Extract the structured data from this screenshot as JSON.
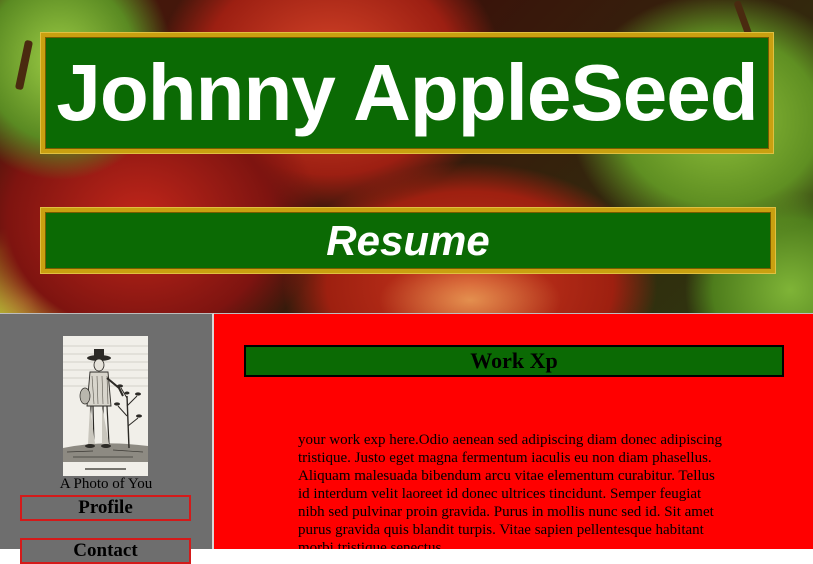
{
  "header": {
    "title": "Johnny AppleSeed",
    "subtitle": "Resume"
  },
  "sidebar": {
    "photo_caption": "A Photo of You",
    "nav": [
      {
        "label": "Profile"
      },
      {
        "label": "Contact"
      }
    ]
  },
  "main": {
    "section_title": "Work Xp",
    "body": "your work exp here.Odio aenean sed adipiscing diam donec adipiscing tristique. Justo eget magna fermentum iaculis eu non diam phasellus. Aliquam malesuada bibendum arcu vitae elementum curabitur. Tellus id interdum velit laoreet id donec ultrices tincidunt. Semper feugiat nibh sed pulvinar proin gravida. Purus in mollis nunc sed id. Sit amet purus gravida quis blandit turpis. Vitae sapien pellentesque habitant morbi tristique senectus."
  },
  "colors": {
    "banner_green": "#0b6a04",
    "banner_border": "#c9a010",
    "content_bg": "#ff0000",
    "sidebar_bg": "#6e6e6e",
    "nav_border": "#d41a1a"
  }
}
